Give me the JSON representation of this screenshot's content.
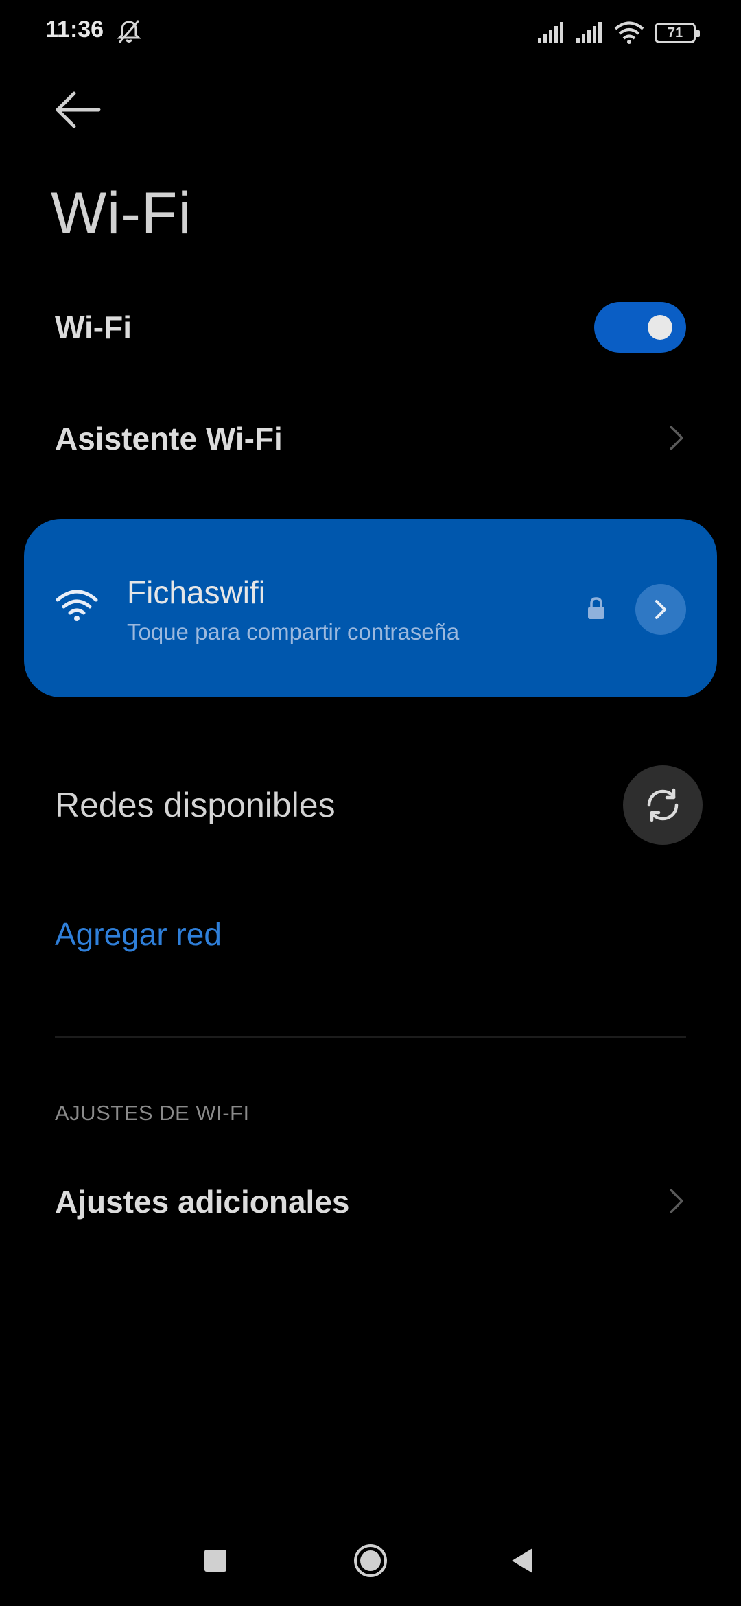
{
  "status_bar": {
    "time": "11:36",
    "battery": "71",
    "icons": [
      "mute-bell-icon",
      "signal-icon",
      "signal-icon",
      "wifi-icon",
      "battery-icon"
    ]
  },
  "header": {
    "back_icon": "arrow-left-icon",
    "title": "Wi-Fi"
  },
  "wifi_toggle": {
    "label": "Wi-Fi",
    "state": "on",
    "accent_color": "#0a5ec5"
  },
  "assistant": {
    "label": "Asistente Wi-Fi"
  },
  "connected_network": {
    "name": "Fichaswifi",
    "subtitle": "Toque para compartir contraseña",
    "icons": [
      "wifi-icon",
      "lock-icon",
      "chevron-right-icon"
    ],
    "card_color": "#0057ad"
  },
  "available": {
    "label": "Redes disponibles",
    "refresh_icon": "refresh-icon"
  },
  "add_network": {
    "label": "Agregar red",
    "color": "#2f7fd9"
  },
  "settings_section": {
    "header": "AJUSTES DE WI-FI",
    "items": [
      {
        "label": "Ajustes adicionales"
      }
    ]
  },
  "nav_bar": {
    "icons": [
      "recents-square-icon",
      "home-circle-icon",
      "back-triangle-icon"
    ]
  }
}
